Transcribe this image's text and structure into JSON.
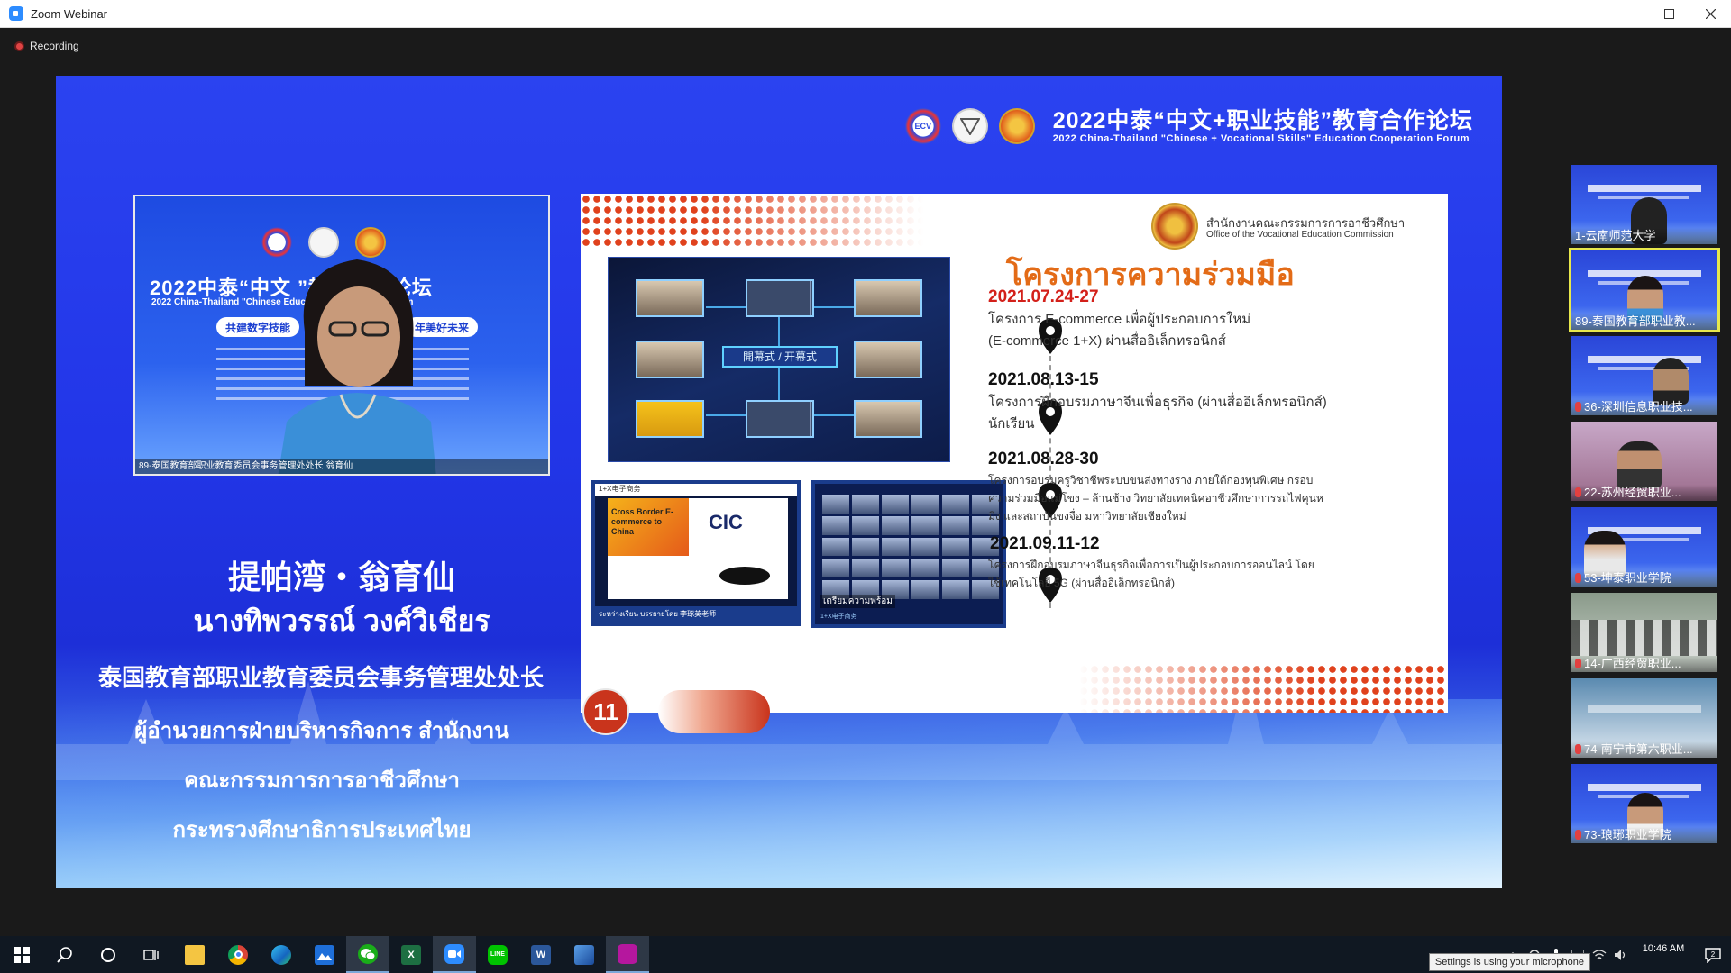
{
  "window": {
    "title": "Zoom Webinar"
  },
  "recording": {
    "label": "Recording"
  },
  "forum": {
    "title_cn": "2022中泰“中文+职业技能”教育合作论坛",
    "title_en": "2022 China-Thailand \"Chinese + Vocational Skills\" Education Cooperation Forum",
    "logo_ecv": "ECV"
  },
  "speaker_video": {
    "title_cn": "2022中泰“中文                ”教育合作论坛",
    "title_en": "2022 China-Thailand \"Chinese                         Education Cooperation Forum",
    "pill_left": "共建数字技能",
    "pill_right": "年美好未来",
    "caption": "89-泰国教育部职业教育委员会事务管理处处长 翁育仙"
  },
  "speaker": {
    "name_cn": "提帕湾・翁育仙",
    "name_th": "นางทิพวรรณ์ วงศ์วิเชียร",
    "title_cn": "泰国教育部职业教育委员会事务管理处处长",
    "title_th_lines": [
      "ผู้อำนวยการฝ่ายบริหารกิจการ สำนักงาน",
      "คณะกรรมการการอาชีวศึกษา",
      "กระทรวงศึกษาธิการประเทศไทย"
    ]
  },
  "slide": {
    "org_th": "สำนักงานคณะกรรมการการอาชีวศึกษา",
    "org_en": "Office of the Vocational Education Commission",
    "heading": "โครงการความร่วมมือ",
    "meeting_center_label": "開幕式 / 开幕式",
    "cbec_top": "1+X电子商务",
    "cbec_title": "Cross Border E-commerce to China",
    "cbec_logo": "CIC",
    "cbec_footer": "ระหว่างเรียน บรรยายโดย 李琢英老师",
    "gallery_caption": "เตรียมความพร้อม",
    "gallery_tag": "1+X电子商务",
    "page_number": "11",
    "events": [
      {
        "date": "2021.07.24-27",
        "desc": [
          "โครงการ E-commerce เพื่อผู้ประกอบการใหม่",
          "(E-commerce 1+X) ผ่านสื่ออิเล็กทรอนิกส์"
        ]
      },
      {
        "date": "2021.08.13-15",
        "desc": [
          "โครงการฝึกอบรมภาษาจีนเพื่อธุรกิจ (ผ่านสื่ออิเล็กทรอนิกส์)",
          "นักเรียน"
        ]
      },
      {
        "date": "2021.08.28-30",
        "desc": [
          "โครงการอบรมครูวิชาชีพระบบขนส่งทางราง ภายใต้กองทุนพิเศษ กรอบ",
          "ความร่วมมือแม่โขง – ล้านช้าง วิทยาลัยเทคนิคอาชีวศึกษาการรถไฟคุนห",
          "มิง และสถาบันขงจื่อ มหาวิทยาลัยเชียงใหม่"
        ]
      },
      {
        "date": "2021.09.11-12",
        "desc": [
          "โครงการฝึกอบรมภาษาจีนธุรกิจเพื่อการเป็นผู้ประกอบการออนไลน์ โดย",
          "ใช้เทคโนโลยี 5G (ผ่านสื่ออิเล็กทรอนิกส์)"
        ]
      }
    ],
    "colors": {
      "date_red": "#d3201a",
      "date_black": "#111111",
      "heading_orange": "#e36b17",
      "dots": "#e0421d"
    }
  },
  "participants": [
    {
      "label": "1-云南师范大学",
      "muted": false
    },
    {
      "label": "89-泰国教育部职业教...",
      "muted": false,
      "active": true
    },
    {
      "label": "36-深圳信息职业技...",
      "muted": true
    },
    {
      "label": "22-苏州经贸职业...",
      "muted": true
    },
    {
      "label": "53-坤泰职业学院",
      "muted": true
    },
    {
      "label": "14-广西经贸职业...",
      "muted": true
    },
    {
      "label": "74-南宁市第六职业...",
      "muted": true
    },
    {
      "label": "73-琅琊职业学院",
      "muted": true
    }
  ],
  "taskbar": {
    "apps": [
      "start",
      "search",
      "cortana",
      "task-view",
      "file-explorer",
      "chrome",
      "edge",
      "photos",
      "wechat",
      "excel",
      "zoom",
      "line",
      "word",
      "paint",
      "pdf"
    ],
    "excel_letter": "X",
    "word_letter": "W",
    "line_text": "LINE",
    "time": "10:46 AM",
    "notification_count": "2",
    "tooltip": "Settings is using your microphone"
  }
}
